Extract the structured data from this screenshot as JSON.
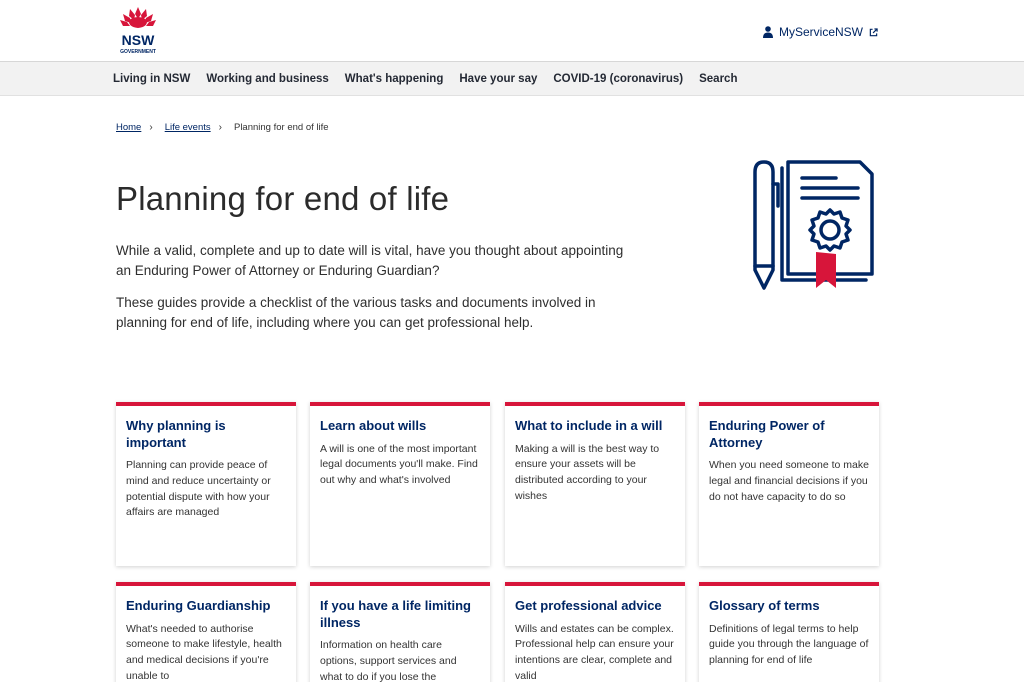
{
  "header": {
    "logo": {
      "top_text": "NSW",
      "bottom_text": "GOVERNMENT"
    },
    "myservice_label": "MyServiceNSW"
  },
  "nav": {
    "items": [
      {
        "label": "Living in NSW"
      },
      {
        "label": "Working and business"
      },
      {
        "label": "What's happening"
      },
      {
        "label": "Have your say"
      },
      {
        "label": "COVID-19 (coronavirus)"
      },
      {
        "label": "Search"
      }
    ]
  },
  "breadcrumb": {
    "items": [
      {
        "label": "Home"
      },
      {
        "label": "Life events"
      }
    ],
    "separator": "›",
    "current": "Planning for end of life"
  },
  "main": {
    "title": "Planning for end of life",
    "intro": [
      "While a valid, complete and up to date will is vital, have you thought about appointing an Enduring Power of Attorney or Enduring Guardian?",
      "These guides provide a checklist of the various tasks and documents involved in planning for end of life, including where you can get professional help."
    ]
  },
  "cards": [
    {
      "title": "Why planning is important",
      "description": "Planning can provide peace of mind and reduce uncertainty or potential dispute with how your affairs are managed"
    },
    {
      "title": "Learn about wills",
      "description": "A will is one of the most important legal documents you'll make. Find out why and what's involved"
    },
    {
      "title": "What to include in a will",
      "description": "Making a will is the best way to ensure your assets will be distributed according to your wishes"
    },
    {
      "title": "Enduring Power of Attorney",
      "description": "When you need someone to make legal and financial decisions if you do not have capacity to do so"
    },
    {
      "title": "Enduring Guardianship",
      "description": "What's needed to authorise someone to make lifestyle, health and medical decisions if you're unable to"
    },
    {
      "title": "If you have a life limiting illness",
      "description": "Information on health care options, support services and what to do if you lose the"
    },
    {
      "title": "Get professional advice",
      "description": "Wills and estates can be complex. Professional help can ensure your intentions are clear, complete and valid"
    },
    {
      "title": "Glossary of terms",
      "description": "Definitions of legal terms to help guide you through the language of planning for end of life"
    }
  ],
  "icons": {
    "logo": "nsw-waratah-logo",
    "myservice": "person-icon",
    "external": "external-link-icon",
    "hero": "document-with-pen-and-seal-icon"
  },
  "colors": {
    "primary_navy": "#002664",
    "accent_red": "#d7153a",
    "nav_background": "#f2f2f2"
  }
}
